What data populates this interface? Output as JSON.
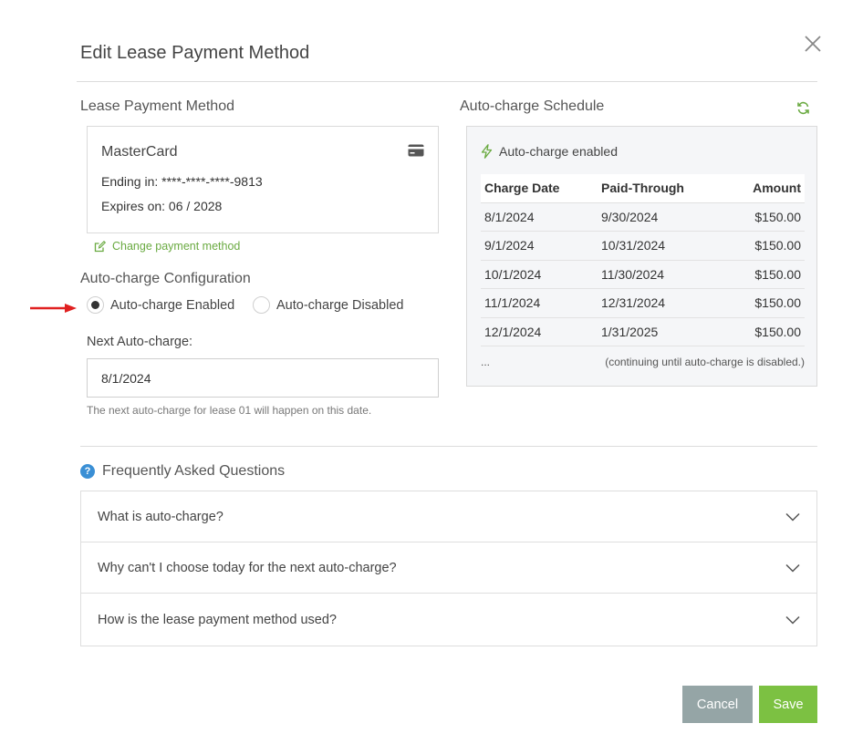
{
  "modal": {
    "title": "Edit Lease Payment Method"
  },
  "payment_method": {
    "section_title": "Lease Payment Method",
    "card_name": "MasterCard",
    "ending": "Ending in: ****-****-****-9813",
    "expires": "Expires on: 06 / 2028",
    "change_link": "Change payment method"
  },
  "config": {
    "section_title": "Auto-charge Configuration",
    "enabled_label": "Auto-charge Enabled",
    "disabled_label": "Auto-charge Disabled",
    "selected": "enabled",
    "next_label": "Next Auto-charge:",
    "next_value": "8/1/2024",
    "helper": "The next auto-charge for lease 01 will happen on this date."
  },
  "schedule": {
    "section_title": "Auto-charge Schedule",
    "status": "Auto-charge enabled",
    "columns": [
      "Charge Date",
      "Paid-Through",
      "Amount"
    ],
    "rows": [
      [
        "8/1/2024",
        "9/30/2024",
        "$150.00"
      ],
      [
        "9/1/2024",
        "10/31/2024",
        "$150.00"
      ],
      [
        "10/1/2024",
        "11/30/2024",
        "$150.00"
      ],
      [
        "11/1/2024",
        "12/31/2024",
        "$150.00"
      ],
      [
        "12/1/2024",
        "1/31/2025",
        "$150.00"
      ]
    ],
    "ellipsis": "...",
    "continuing": "(continuing until auto-charge is disabled.)"
  },
  "faq": {
    "title": "Frequently Asked Questions",
    "items": [
      {
        "question": "What is auto-charge?"
      },
      {
        "question": "Why can't I choose today for the next auto-charge?"
      },
      {
        "question": "How is the lease payment method used?"
      }
    ]
  },
  "buttons": {
    "cancel": "Cancel",
    "save": "Save"
  },
  "colors": {
    "accent_green": "#7cc142",
    "link_green": "#6aaa41",
    "cancel_gray": "#95a5a6",
    "help_blue": "#3a8fd5",
    "arrow_red": "#e02020"
  }
}
